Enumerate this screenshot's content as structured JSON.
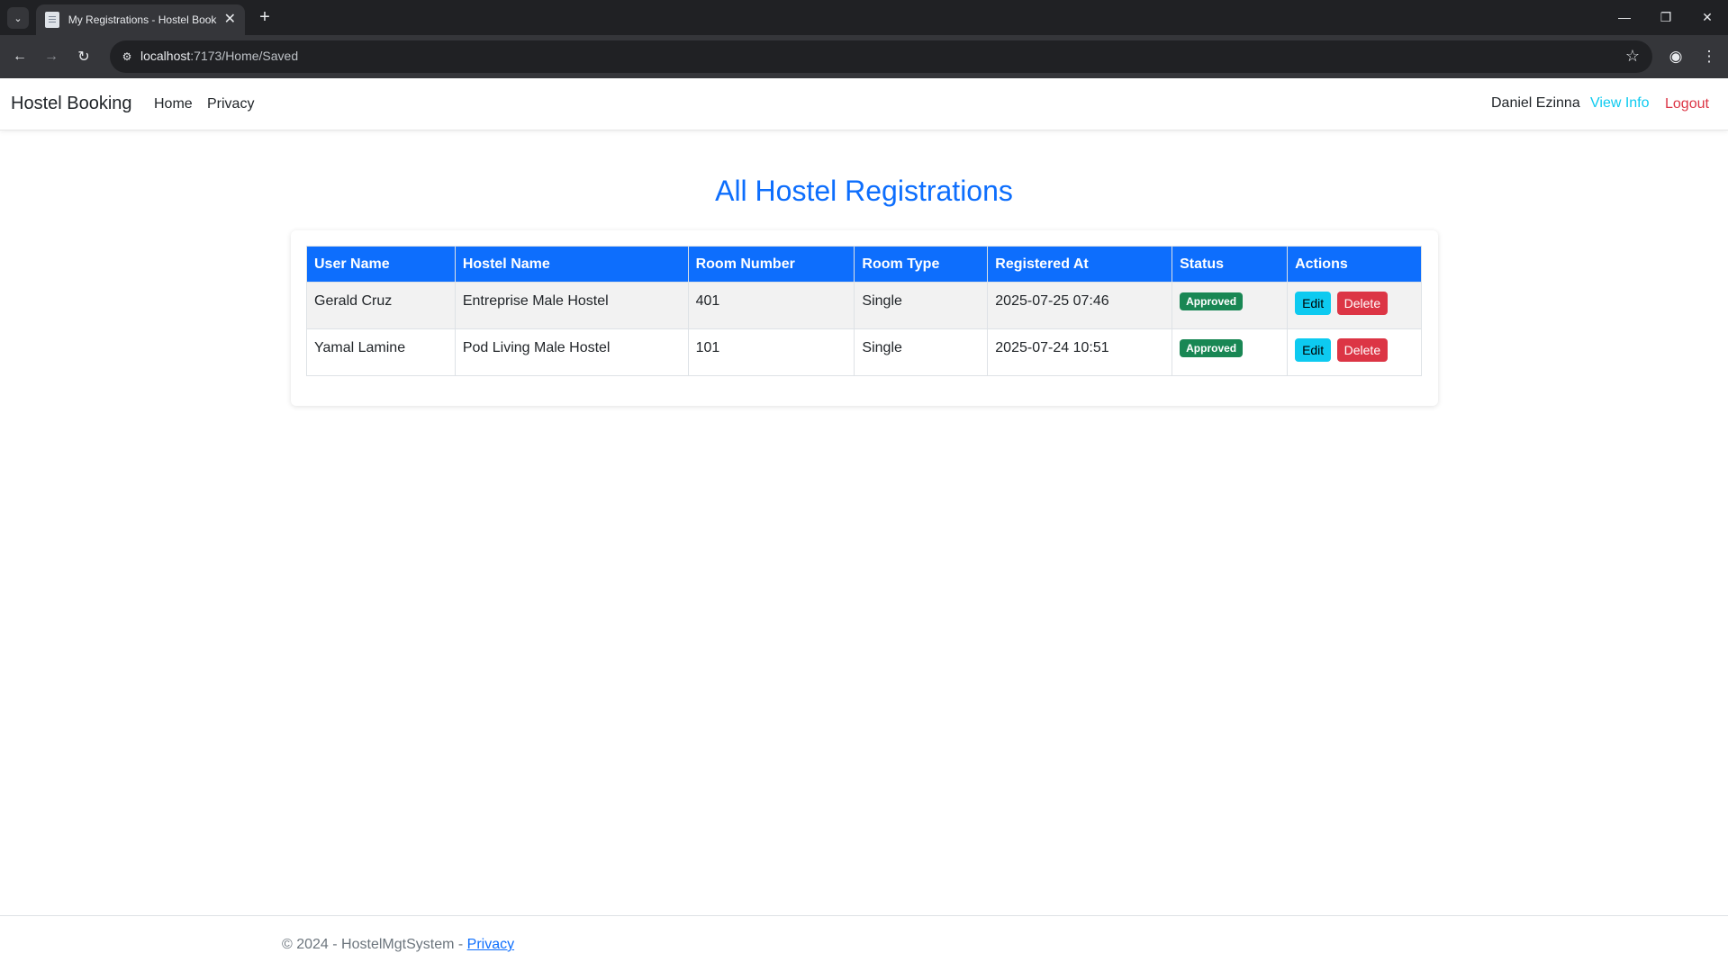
{
  "browser": {
    "tab_title": "My Registrations - Hostel Booki",
    "url_host": "localhost",
    "url_rest": ":7173/Home/Saved",
    "new_tab": "+",
    "tab_close": "✕"
  },
  "navbar": {
    "brand": "Hostel Booking",
    "links": [
      "Home",
      "Privacy"
    ],
    "user_name": "Daniel Ezinna",
    "view_info": "View Info",
    "logout": "Logout"
  },
  "main": {
    "title": "All Hostel Registrations",
    "columns": [
      "User Name",
      "Hostel Name",
      "Room Number",
      "Room Type",
      "Registered At",
      "Status",
      "Actions"
    ],
    "rows": [
      {
        "user": "Gerald Cruz",
        "hostel": "Entreprise Male Hostel",
        "room": "401",
        "type": "Single",
        "registered": "2025-07-25 07:46",
        "status": "Approved",
        "edit": "Edit",
        "delete": "Delete"
      },
      {
        "user": "Yamal Lamine",
        "hostel": "Pod Living Male Hostel",
        "room": "101",
        "type": "Single",
        "registered": "2025-07-24 10:51",
        "status": "Approved",
        "edit": "Edit",
        "delete": "Delete"
      }
    ]
  },
  "footer": {
    "text": "© 2024 - HostelMgtSystem - ",
    "link": "Privacy"
  },
  "colors": {
    "primary": "#0d6efd",
    "success": "#198754",
    "info": "#0dcaf0",
    "danger": "#dc3545"
  },
  "icons": [
    "tab-list-icon",
    "page-favicon-icon",
    "close-icon",
    "plus-icon",
    "minimize-icon",
    "restore-icon",
    "window-close-icon",
    "back-icon",
    "forward-icon",
    "reload-icon",
    "site-info-icon",
    "star-icon",
    "profile-icon",
    "kebab-menu-icon"
  ]
}
